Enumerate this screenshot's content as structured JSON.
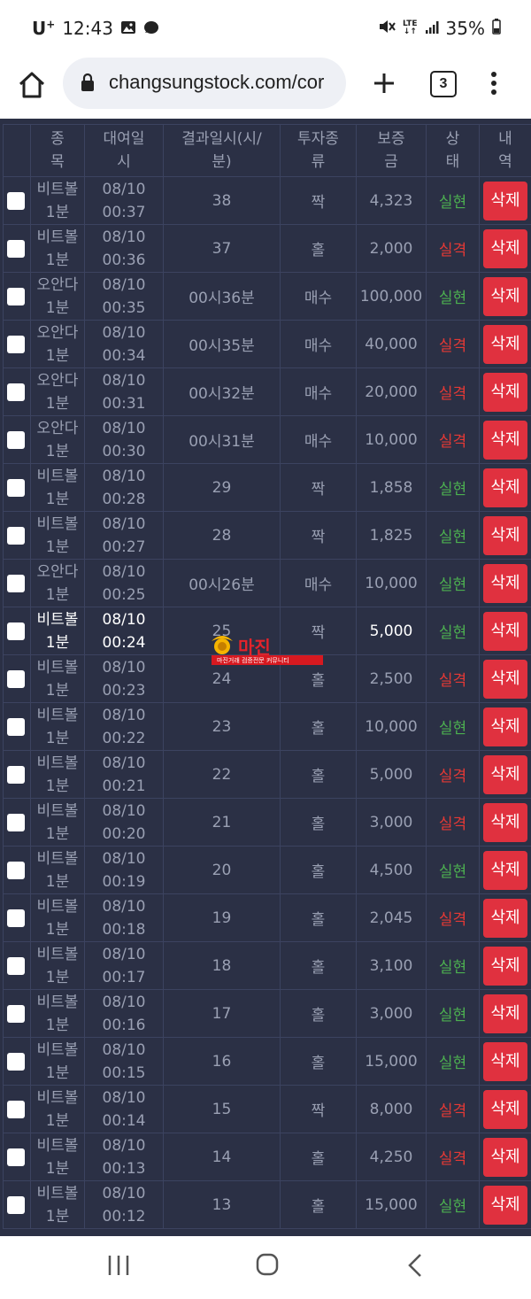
{
  "status": {
    "carrier": "U",
    "carrier_sup": "+",
    "time": "12:43",
    "lte": "LTE",
    "battery": "35%"
  },
  "browser": {
    "url": "changsungstock.com/cor",
    "tab_count": "3"
  },
  "table": {
    "headers": {
      "item": [
        "종",
        "목"
      ],
      "date": [
        "대여일",
        "시"
      ],
      "result_time": [
        "결과일시(시/",
        "분)"
      ],
      "bet_type": [
        "투자종",
        "류"
      ],
      "deposit": [
        "보증",
        "금"
      ],
      "status": [
        "상",
        "태"
      ],
      "detail": [
        "내",
        "역"
      ]
    },
    "delete_label": "삭제",
    "rows": [
      {
        "item1": "비트볼",
        "item2": "1분",
        "date": "08/10",
        "time": "00:37",
        "result": "38",
        "type": "짝",
        "amount": "4,323",
        "status": "실현",
        "win": true
      },
      {
        "item1": "비트볼",
        "item2": "1분",
        "date": "08/10",
        "time": "00:36",
        "result": "37",
        "type": "홀",
        "amount": "2,000",
        "status": "실격",
        "win": false
      },
      {
        "item1": "오안다",
        "item2": "1분",
        "date": "08/10",
        "time": "00:35",
        "result": "00시36분",
        "type": "매수",
        "amount": "100,000",
        "status": "실현",
        "win": true
      },
      {
        "item1": "오안다",
        "item2": "1분",
        "date": "08/10",
        "time": "00:34",
        "result": "00시35분",
        "type": "매수",
        "amount": "40,000",
        "status": "실격",
        "win": false
      },
      {
        "item1": "오안다",
        "item2": "1분",
        "date": "08/10",
        "time": "00:31",
        "result": "00시32분",
        "type": "매수",
        "amount": "20,000",
        "status": "실격",
        "win": false
      },
      {
        "item1": "오안다",
        "item2": "1분",
        "date": "08/10",
        "time": "00:30",
        "result": "00시31분",
        "type": "매수",
        "amount": "10,000",
        "status": "실격",
        "win": false
      },
      {
        "item1": "비트볼",
        "item2": "1분",
        "date": "08/10",
        "time": "00:28",
        "result": "29",
        "type": "짝",
        "amount": "1,858",
        "status": "실현",
        "win": true
      },
      {
        "item1": "비트볼",
        "item2": "1분",
        "date": "08/10",
        "time": "00:27",
        "result": "28",
        "type": "짝",
        "amount": "1,825",
        "status": "실현",
        "win": true
      },
      {
        "item1": "오안다",
        "item2": "1분",
        "date": "08/10",
        "time": "00:25",
        "result": "00시26분",
        "type": "매수",
        "amount": "10,000",
        "status": "실현",
        "win": true
      },
      {
        "item1": "비트볼",
        "item2": "1분",
        "date": "08/10",
        "time": "00:24",
        "result": "25",
        "type": "짝",
        "amount": "5,000",
        "status": "실현",
        "win": true,
        "highlight": true
      },
      {
        "item1": "비트볼",
        "item2": "1분",
        "date": "08/10",
        "time": "00:23",
        "result": "24",
        "type": "홀",
        "amount": "2,500",
        "status": "실격",
        "win": false
      },
      {
        "item1": "비트볼",
        "item2": "1분",
        "date": "08/10",
        "time": "00:22",
        "result": "23",
        "type": "홀",
        "amount": "10,000",
        "status": "실현",
        "win": true
      },
      {
        "item1": "비트볼",
        "item2": "1분",
        "date": "08/10",
        "time": "00:21",
        "result": "22",
        "type": "홀",
        "amount": "5,000",
        "status": "실격",
        "win": false
      },
      {
        "item1": "비트볼",
        "item2": "1분",
        "date": "08/10",
        "time": "00:20",
        "result": "21",
        "type": "홀",
        "amount": "3,000",
        "status": "실격",
        "win": false
      },
      {
        "item1": "비트볼",
        "item2": "1분",
        "date": "08/10",
        "time": "00:19",
        "result": "20",
        "type": "홀",
        "amount": "4,500",
        "status": "실현",
        "win": true
      },
      {
        "item1": "비트볼",
        "item2": "1분",
        "date": "08/10",
        "time": "00:18",
        "result": "19",
        "type": "홀",
        "amount": "2,045",
        "status": "실격",
        "win": false
      },
      {
        "item1": "비트볼",
        "item2": "1분",
        "date": "08/10",
        "time": "00:17",
        "result": "18",
        "type": "홀",
        "amount": "3,100",
        "status": "실현",
        "win": true
      },
      {
        "item1": "비트볼",
        "item2": "1분",
        "date": "08/10",
        "time": "00:16",
        "result": "17",
        "type": "홀",
        "amount": "3,000",
        "status": "실현",
        "win": true
      },
      {
        "item1": "비트볼",
        "item2": "1분",
        "date": "08/10",
        "time": "00:15",
        "result": "16",
        "type": "홀",
        "amount": "15,000",
        "status": "실현",
        "win": true
      },
      {
        "item1": "비트볼",
        "item2": "1분",
        "date": "08/10",
        "time": "00:14",
        "result": "15",
        "type": "짝",
        "amount": "8,000",
        "status": "실격",
        "win": false
      },
      {
        "item1": "비트볼",
        "item2": "1분",
        "date": "08/10",
        "time": "00:13",
        "result": "14",
        "type": "홀",
        "amount": "4,250",
        "status": "실격",
        "win": false
      },
      {
        "item1": "비트볼",
        "item2": "1분",
        "date": "08/10",
        "time": "00:12",
        "result": "13",
        "type": "홀",
        "amount": "15,000",
        "status": "실현",
        "win": true
      }
    ]
  },
  "watermark": {
    "title": "마진",
    "subtitle": "마진거래 검증전문 커뮤니티"
  },
  "colors": {
    "page_bg": "#2b3045",
    "win": "#4caf50",
    "lose": "#e53935",
    "delete_button": "#e0313f"
  }
}
